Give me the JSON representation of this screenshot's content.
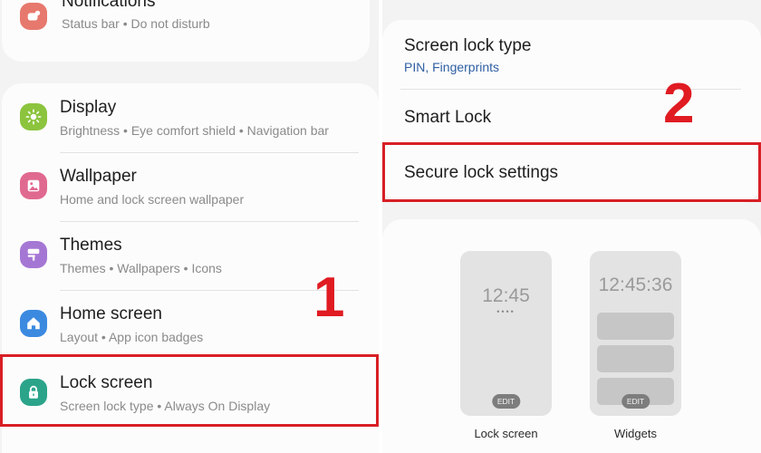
{
  "left_settings": {
    "items": [
      {
        "title": "Notifications",
        "subtitle": "Status bar  •  Do not disturb",
        "icon": "bell-icon",
        "color": "#e7786d"
      },
      {
        "title": "Display",
        "subtitle": "Brightness  •  Eye comfort shield  •  Navigation bar",
        "icon": "sun-icon",
        "color": "#8cc43e"
      },
      {
        "title": "Wallpaper",
        "subtitle": "Home and lock screen wallpaper",
        "icon": "picture-icon",
        "color": "#e0698f"
      },
      {
        "title": "Themes",
        "subtitle": "Themes  •  Wallpapers  •  Icons",
        "icon": "brush-icon",
        "color": "#a577d4"
      },
      {
        "title": "Home screen",
        "subtitle": "Layout  •  App icon badges",
        "icon": "home-icon",
        "color": "#3b8ae0"
      },
      {
        "title": "Lock screen",
        "subtitle": "Screen lock type  •  Always On Display",
        "icon": "lock-icon",
        "color": "#2ba48a"
      }
    ],
    "step_label": "1"
  },
  "right_settings": {
    "items": [
      {
        "title": "Screen lock type",
        "subtitle": "PIN, Fingerprints"
      },
      {
        "title": "Smart Lock"
      },
      {
        "title": "Secure lock settings"
      }
    ],
    "step_label": "2",
    "preview": {
      "lock_time": "12:45",
      "lock_dots": "••••",
      "widgets_time": "12:45:36",
      "edit_label": "EDIT",
      "lock_label": "Lock screen",
      "widgets_label": "Widgets"
    }
  },
  "colors": {
    "highlight": "#d81f26",
    "accent_blue": "#2f5fa3"
  }
}
